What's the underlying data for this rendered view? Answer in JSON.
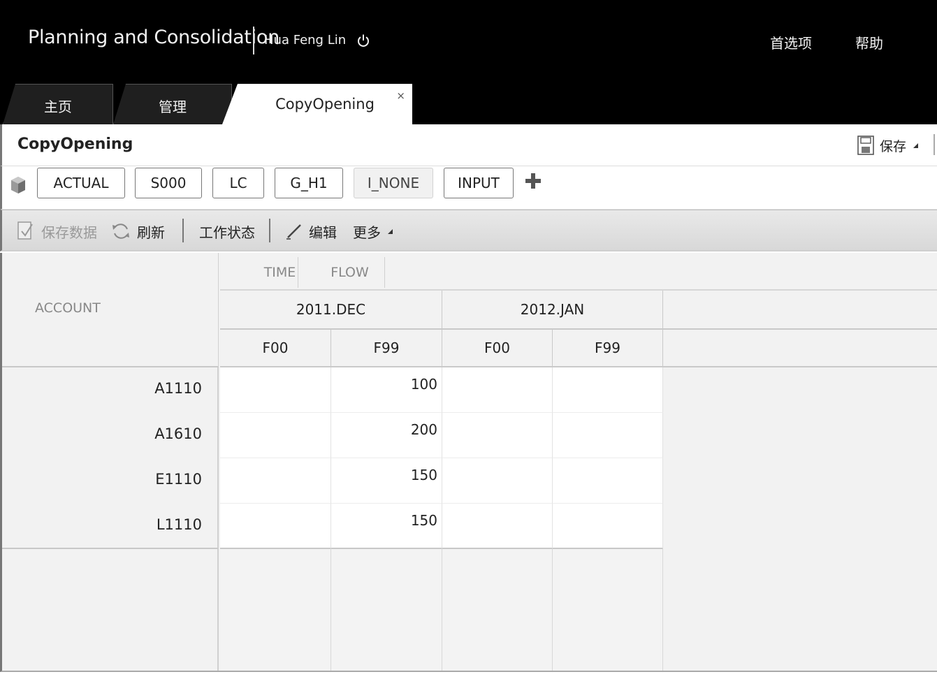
{
  "header": {
    "app_title": "Planning and Consolidation",
    "user_name": "Hua Feng Lin",
    "preferences_label": "首选项",
    "help_label": "帮助"
  },
  "tabs": [
    {
      "label": "主页",
      "active": false
    },
    {
      "label": "管理",
      "active": false
    },
    {
      "label": "CopyOpening",
      "active": true,
      "close_glyph": "×"
    }
  ],
  "page": {
    "title": "CopyOpening",
    "save_label": "保存"
  },
  "context": {
    "members": [
      "ACTUAL",
      "S000",
      "LC",
      "G_H1",
      "I_NONE",
      "INPUT"
    ]
  },
  "toolbar": {
    "save_data_label": "保存数据",
    "refresh_label": "刷新",
    "work_status_label": "工作状态",
    "edit_label": "编辑",
    "more_label": "更多"
  },
  "grid": {
    "row_axis_label": "ACCOUNT",
    "column_axes": [
      "TIME",
      "FLOW"
    ],
    "periods": [
      "2011.DEC",
      "2012.JAN"
    ],
    "flows": [
      "F00",
      "F99",
      "F00",
      "F99"
    ],
    "rows": [
      {
        "account": "A1110",
        "values": [
          "",
          "100",
          "",
          ""
        ]
      },
      {
        "account": "A1610",
        "values": [
          "",
          "200",
          "",
          ""
        ]
      },
      {
        "account": "E1110",
        "values": [
          "",
          "150",
          "",
          ""
        ]
      },
      {
        "account": "L1110",
        "values": [
          "",
          "150",
          "",
          ""
        ]
      }
    ]
  },
  "colors": {
    "header_bg": "#000000",
    "toolbar_bg": "#dddddd",
    "grid_bg": "#f2f2f2"
  },
  "icons": [
    "power-icon",
    "floppy-disk-icon",
    "dropdown-triangle-icon",
    "context-cube-icon",
    "add-member-icon",
    "save-data-icon",
    "refresh-icon",
    "pencil-icon",
    "close-icon"
  ]
}
